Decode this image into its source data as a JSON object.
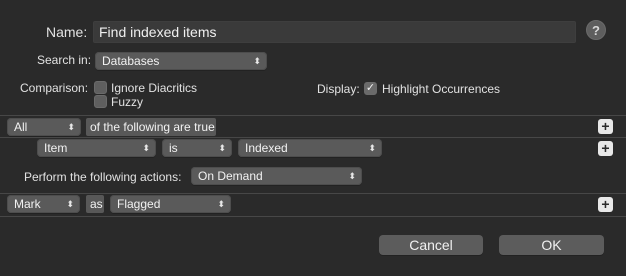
{
  "name": {
    "label": "Name:",
    "value": "Find indexed items"
  },
  "help": {
    "glyph": "?"
  },
  "search_in": {
    "label": "Search in:",
    "value": "Databases"
  },
  "comparison": {
    "label": "Comparison:",
    "options": [
      {
        "label": "Ignore Diacritics",
        "checked": false
      },
      {
        "label": "Fuzzy",
        "checked": false
      }
    ]
  },
  "display": {
    "label": "Display:",
    "option": {
      "label": "Highlight Occurrences",
      "checked": true
    },
    "tick": "✓"
  },
  "match": {
    "mode": "All",
    "suffix": "of the following are true"
  },
  "condition": {
    "field": "Item",
    "operator": "is",
    "value": "Indexed"
  },
  "actions": {
    "label": "Perform the following actions:",
    "value": "On Demand"
  },
  "action_row": {
    "action": "Mark",
    "as_label": "as",
    "target": "Flagged"
  },
  "plus_glyph": "+",
  "buttons": {
    "cancel": "Cancel",
    "ok": "OK"
  },
  "colors": {
    "background": "#2a2a2a",
    "control": "#5a5a5a",
    "separator": "#474747"
  },
  "icons": {
    "popup": "chevron-updown-icon",
    "add": "plus-icon",
    "help": "question-icon",
    "check": "checkmark-icon"
  }
}
